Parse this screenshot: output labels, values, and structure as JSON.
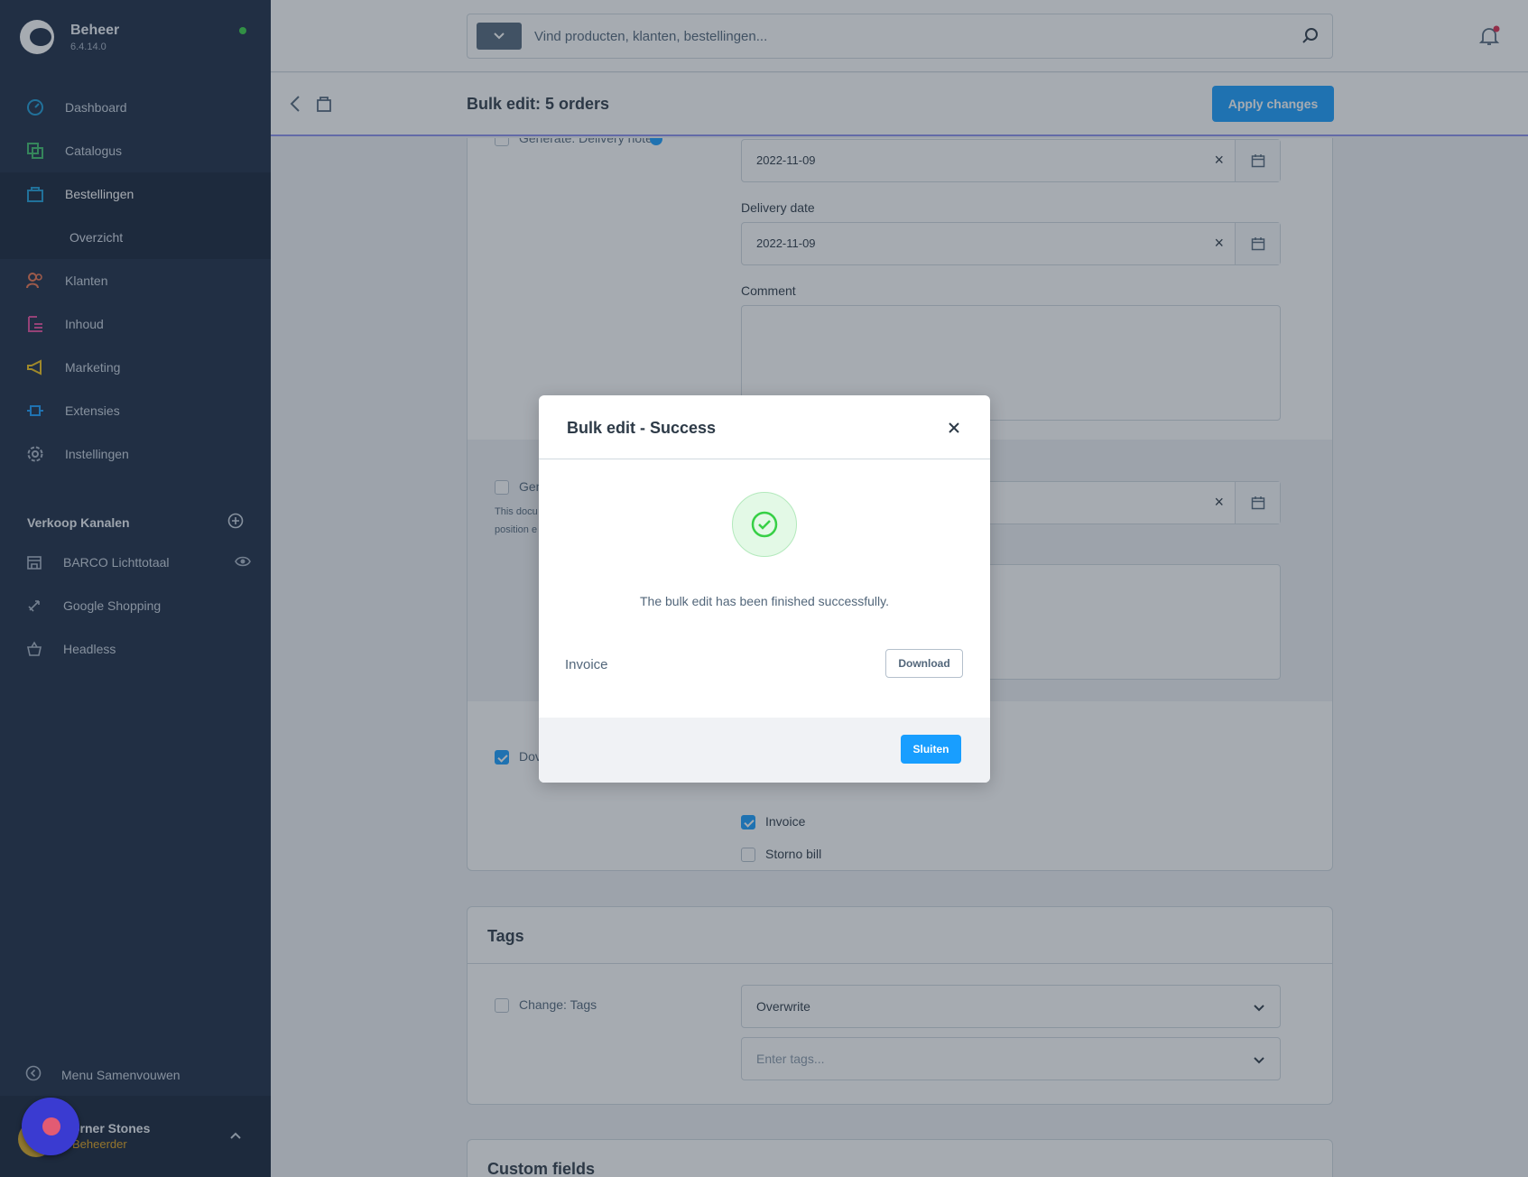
{
  "app": {
    "name": "Beheer",
    "version": "6.4.14.0"
  },
  "sidebar": {
    "items": [
      {
        "label": "Dashboard",
        "icon": "dashboard-gauge-icon",
        "color": "#1b9bd8"
      },
      {
        "label": "Catalogus",
        "icon": "catalog-icon",
        "color": "#3dbd6b"
      },
      {
        "label": "Bestellingen",
        "icon": "orders-bag-icon",
        "color": "#1b9bd8"
      },
      {
        "label": "Overzicht"
      },
      {
        "label": "Klanten",
        "icon": "customers-icon",
        "color": "#f0744e"
      },
      {
        "label": "Inhoud",
        "icon": "content-icon",
        "color": "#e24b9c"
      },
      {
        "label": "Marketing",
        "icon": "megaphone-icon",
        "color": "#f5c518"
      },
      {
        "label": "Extensies",
        "icon": "plug-icon",
        "color": "#189eff"
      },
      {
        "label": "Instellingen",
        "icon": "gear-icon",
        "color": "#a7b3c4"
      }
    ],
    "sales_channels_title": "Verkoop Kanalen",
    "channels": [
      {
        "label": "BARCO Lichttotaal",
        "icon": "storefront-icon"
      },
      {
        "label": "Google Shopping",
        "icon": "rocket-icon"
      },
      {
        "label": "Headless",
        "icon": "basket-icon"
      }
    ],
    "collapse_label": "Menu Samenvouwen",
    "user": {
      "name": "orner Stones",
      "role": "Beheerder"
    }
  },
  "search": {
    "placeholder": "Vind producten, klanten, bestellingen..."
  },
  "smartbar": {
    "title": "Bulk edit: 5 orders",
    "apply_label": "Apply changes"
  },
  "form": {
    "generate_delivery_note": "Generate: Delivery note",
    "date_value": "2022-11-09",
    "delivery_date_label": "Delivery date",
    "delivery_date_value": "2022-11-09",
    "comment_label": "Comment",
    "gen_truncated": "Gen",
    "help_line1": "This docu",
    "help_line2": "position e",
    "download_truncated": "Dov",
    "doc_types": [
      {
        "label": "Invoice",
        "checked": true
      },
      {
        "label": "Storno bill",
        "checked": false
      }
    ]
  },
  "tags": {
    "title": "Tags",
    "change_label": "Change: Tags",
    "mode_value": "Overwrite",
    "tags_placeholder": "Enter tags..."
  },
  "custom_fields": {
    "title": "Custom fields"
  },
  "modal": {
    "title": "Bulk edit - Success",
    "message": "The bulk edit has been finished successfully.",
    "document_label": "Invoice",
    "download_label": "Download",
    "close_label": "Sluiten",
    "success_color": "#37d046"
  }
}
